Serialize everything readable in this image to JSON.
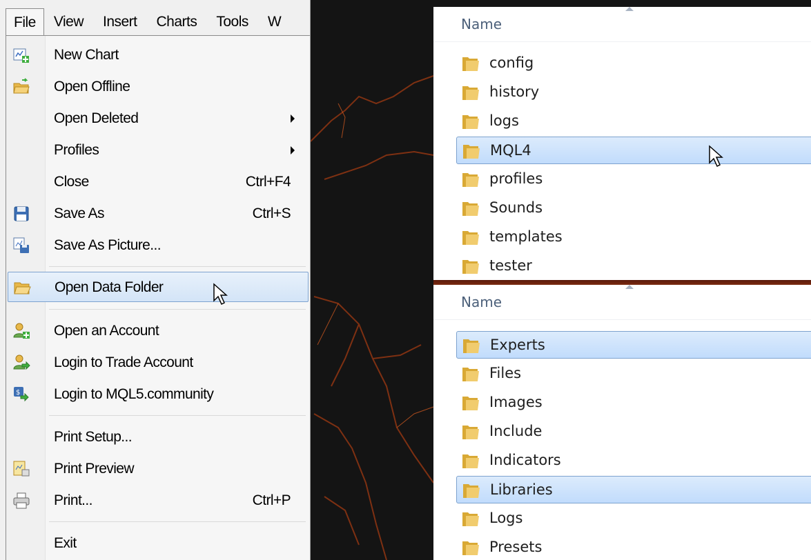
{
  "menubar": {
    "items": [
      "File",
      "View",
      "Insert",
      "Charts",
      "Tools",
      "W"
    ]
  },
  "file_menu": {
    "items": [
      {
        "label": "New Chart",
        "icon": "new-chart-icon"
      },
      {
        "label": "Open Offline",
        "icon": "open-folder-icon"
      },
      {
        "label": "Open Deleted",
        "submenu": true
      },
      {
        "label": "Profiles",
        "submenu": true
      },
      {
        "label": "Close",
        "shortcut": "Ctrl+F4"
      },
      {
        "label": "Save As",
        "shortcut": "Ctrl+S",
        "icon": "floppy-disk-icon"
      },
      {
        "label": "Save As Picture...",
        "icon": "save-picture-icon"
      },
      {
        "label": "Open Data Folder",
        "icon": "open-data-folder-icon",
        "highlighted": true
      },
      {
        "label": "Open an Account",
        "icon": "add-user-icon"
      },
      {
        "label": "Login to Trade Account",
        "icon": "login-user-icon"
      },
      {
        "label": "Login to MQL5.community",
        "icon": "mql5-login-icon"
      },
      {
        "label": "Print Setup..."
      },
      {
        "label": "Print Preview",
        "icon": "print-preview-icon"
      },
      {
        "label": "Print...",
        "shortcut": "Ctrl+P",
        "icon": "printer-icon"
      },
      {
        "label": "Exit"
      }
    ]
  },
  "explorer_top": {
    "column_name": "Name",
    "folders": [
      {
        "name": "config"
      },
      {
        "name": "history"
      },
      {
        "name": "logs"
      },
      {
        "name": "MQL4",
        "selected": true
      },
      {
        "name": "profiles"
      },
      {
        "name": "Sounds"
      },
      {
        "name": "templates"
      },
      {
        "name": "tester"
      }
    ]
  },
  "explorer_bottom": {
    "column_name": "Name",
    "folders": [
      {
        "name": "Experts",
        "selected": true
      },
      {
        "name": "Files"
      },
      {
        "name": "Images"
      },
      {
        "name": "Include"
      },
      {
        "name": "Indicators"
      },
      {
        "name": "Libraries",
        "selected": true
      },
      {
        "name": "Logs"
      },
      {
        "name": "Presets"
      }
    ]
  },
  "colors": {
    "menu_highlight_border": "#7da2ce",
    "folder_yellow": "#e8c15a",
    "lightning": "#c8561f"
  }
}
